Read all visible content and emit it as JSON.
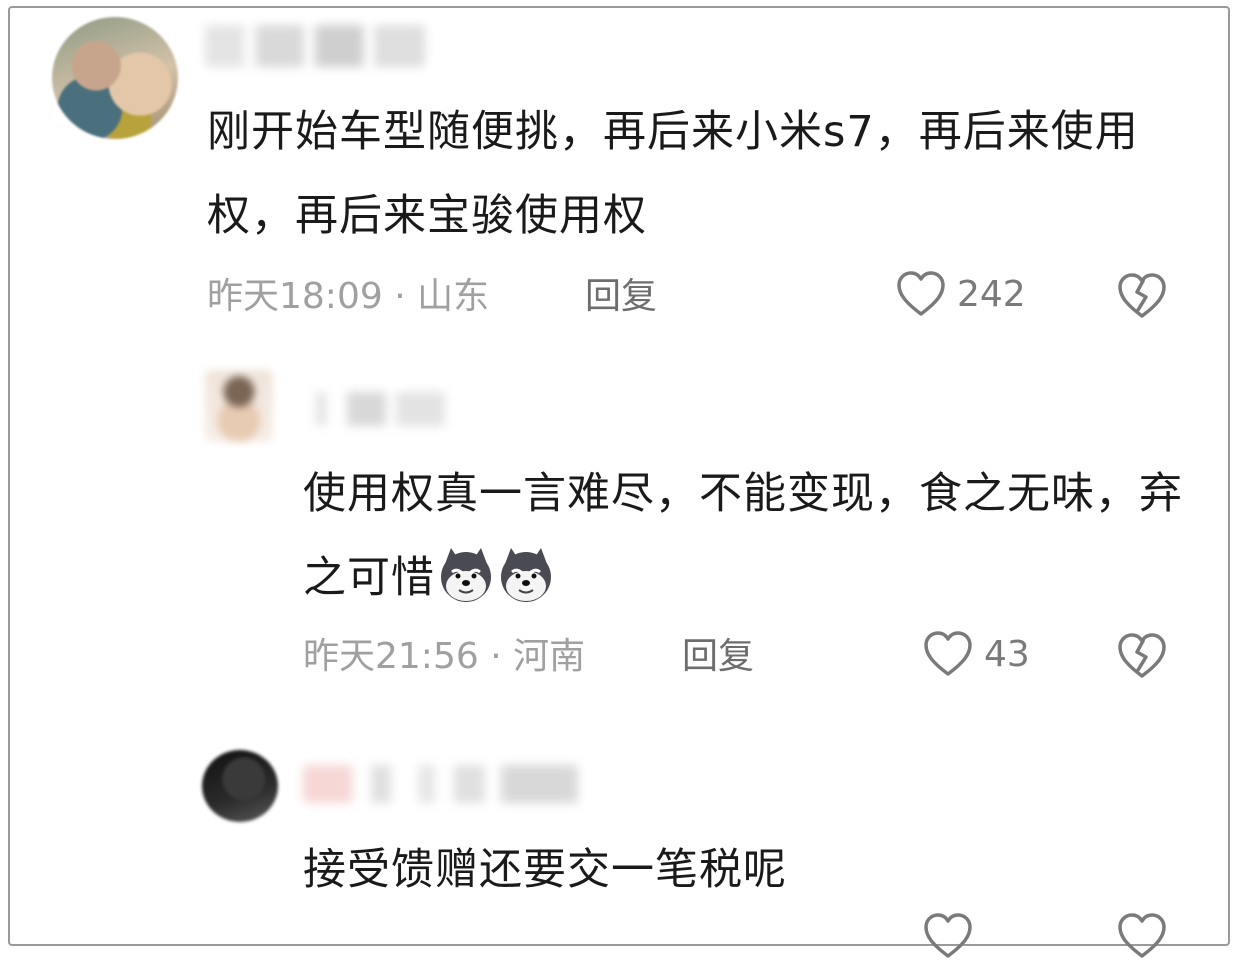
{
  "comments": [
    {
      "text": "刚开始车型随便挑，再后来小米s7，再后来使用权，再后来宝骏使用权",
      "time_location": "昨天18:09 · 山东",
      "reply_label": "回复",
      "likes": "242"
    },
    {
      "text": "使用权真一言难尽，不能变现，食之无味，弃之可惜",
      "time_location": "昨天21:56 · 河南",
      "reply_label": "回复",
      "likes": "43"
    },
    {
      "text": "接受馈赠还要交一笔税呢"
    }
  ],
  "icons": {
    "like": "heart-outline-icon",
    "dislike": "broken-heart-icon",
    "emoji": "husky-doge-emoji"
  },
  "colors": {
    "text": "#1a1a1a",
    "meta": "#a0a0a0",
    "reply": "#6d6d6d",
    "icon": "#7a7a7a"
  }
}
